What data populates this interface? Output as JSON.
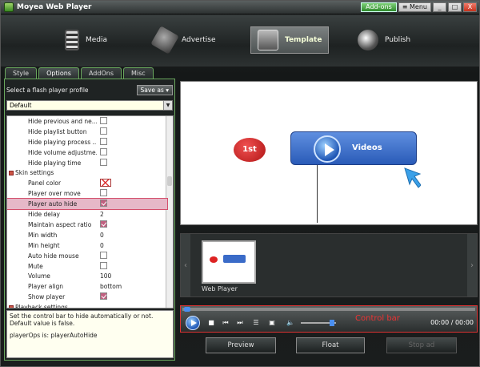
{
  "window": {
    "title": "Moyea Web Player",
    "addons_label": "Add-ons",
    "menu_label": "Menu",
    "minimize": "_",
    "restore": "□",
    "close": "X"
  },
  "nav": {
    "items": [
      {
        "label": "Media",
        "icon": "film-strip-icon"
      },
      {
        "label": "Advertise",
        "icon": "advertise-icon"
      },
      {
        "label": "Template",
        "icon": "template-icon",
        "active": true
      },
      {
        "label": "Publish",
        "icon": "publish-globe-icon"
      }
    ]
  },
  "tabs": [
    "Style",
    "Options",
    "AddOns",
    "Misc"
  ],
  "active_tab": "Options",
  "profile": {
    "label": "Select a flash player profile",
    "save_as": "Save as",
    "selected": "Default"
  },
  "properties": [
    {
      "name": "Hide previous and ne...",
      "value": "",
      "control": "checkbox",
      "checked": false
    },
    {
      "name": "Hide playlist button",
      "value": "",
      "control": "checkbox",
      "checked": false
    },
    {
      "name": "Hide playing process ...",
      "value": "",
      "control": "checkbox",
      "checked": false
    },
    {
      "name": "Hide volume adjustme...",
      "value": "",
      "control": "checkbox",
      "checked": false
    },
    {
      "name": "Hide playing time",
      "value": "",
      "control": "checkbox",
      "checked": false
    },
    {
      "name": "Skin settings",
      "value": "",
      "control": "section"
    },
    {
      "name": "Panel color",
      "value": "",
      "control": "color"
    },
    {
      "name": "Player over move",
      "value": "",
      "control": "checkbox",
      "checked": false
    },
    {
      "name": "Player auto hide",
      "value": "",
      "control": "checkbox",
      "checked": true,
      "highlight": true
    },
    {
      "name": "Hide delay",
      "value": "2",
      "control": "text"
    },
    {
      "name": "Maintain aspect ratio",
      "value": "",
      "control": "checkbox",
      "checked": true
    },
    {
      "name": "Min width",
      "value": "0",
      "control": "text"
    },
    {
      "name": "Min height",
      "value": "0",
      "control": "text"
    },
    {
      "name": "Auto hide mouse",
      "value": "",
      "control": "checkbox",
      "checked": false
    },
    {
      "name": "Mute",
      "value": "",
      "control": "checkbox",
      "checked": false
    },
    {
      "name": "Volume",
      "value": "100",
      "control": "text"
    },
    {
      "name": "Player align",
      "value": "bottom",
      "control": "text"
    },
    {
      "name": "Show player",
      "value": "",
      "control": "checkbox",
      "checked": true
    },
    {
      "name": "Playback settings",
      "value": "",
      "control": "section"
    }
  ],
  "description": {
    "line1": "Set the control bar to hide automatically or not.",
    "line2": "Default value is false.",
    "line3": "playerOps is: playerAutoHide"
  },
  "preview": {
    "badge": "1st",
    "button_label": "Videos"
  },
  "strip": {
    "thumb_label": "Web Player",
    "left_arrow": "‹",
    "right_arrow": "›"
  },
  "controlbar": {
    "label": "Control bar",
    "time": "00:00 / 00:00"
  },
  "buttons": {
    "preview": "Preview",
    "float": "Float",
    "stop_ad": "Stop ad"
  },
  "colors": {
    "accent_green": "#6aa85e",
    "highlight_red": "#d33333",
    "player_blue": "#2a5bb8"
  }
}
